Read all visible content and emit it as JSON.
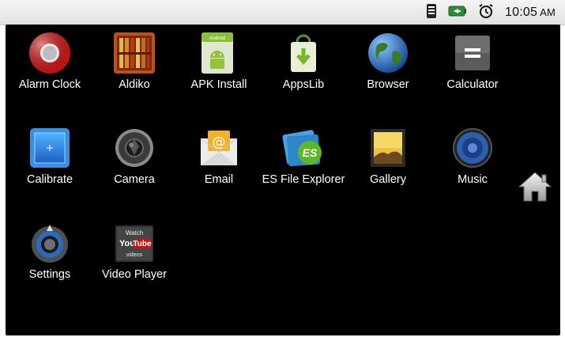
{
  "status_bar": {
    "time": "10:05",
    "ampm": "AM",
    "icons": [
      "signal-icon",
      "battery-icon",
      "alarm-icon"
    ]
  },
  "apps": [
    {
      "label": "Alarm Clock",
      "icon": "alarm-clock-icon"
    },
    {
      "label": "Aldiko",
      "icon": "aldiko-bookshelf-icon"
    },
    {
      "label": "APK Install",
      "icon": "apk-install-android-icon"
    },
    {
      "label": "AppsLib",
      "icon": "appslib-bag-icon"
    },
    {
      "label": "Browser",
      "icon": "globe-icon"
    },
    {
      "label": "Calculator",
      "icon": "calculator-icon"
    },
    {
      "label": "Calibrate",
      "icon": "calibrate-icon"
    },
    {
      "label": "Camera",
      "icon": "camera-icon"
    },
    {
      "label": "Email",
      "icon": "email-envelope-icon"
    },
    {
      "label": "ES File Explorer",
      "icon": "es-file-explorer-icon"
    },
    {
      "label": "Gallery",
      "icon": "gallery-icon"
    },
    {
      "label": "Music",
      "icon": "music-speaker-icon"
    },
    {
      "label": "Settings",
      "icon": "settings-dial-icon"
    },
    {
      "label": "Video Player",
      "icon": "youtube-icon"
    }
  ],
  "icon_text": {
    "apk_android": "Android",
    "yt_watch": "Watch",
    "yt_you": "You",
    "yt_tube": "Tube",
    "yt_videos": "videos",
    "email_at": "@",
    "es_letters": "ES"
  },
  "colors": {
    "screen_bg": "#000000",
    "label_text": "#ffffff",
    "status_bar_bg": "#e8e8e8",
    "battery_green": "#2e8b3a"
  }
}
